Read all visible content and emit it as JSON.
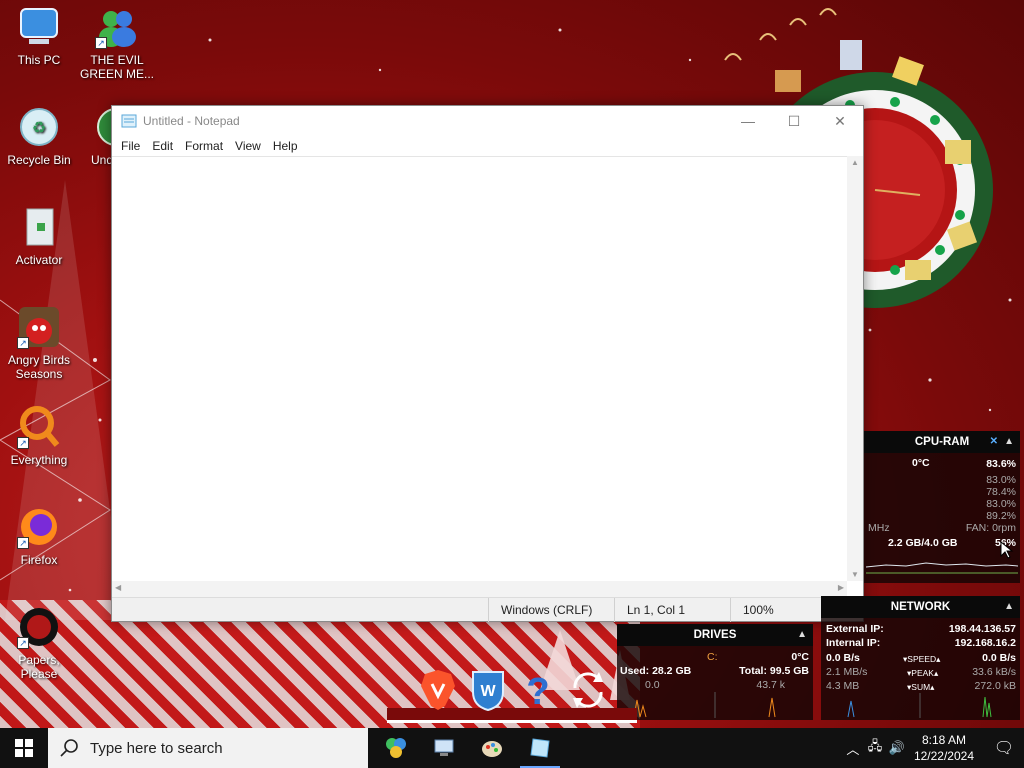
{
  "desktop": {
    "icons": [
      {
        "label": "This PC",
        "icon": "computer-icon"
      },
      {
        "label": "THE EVIL GREEN ME...",
        "icon": "messenger-people-icon"
      },
      {
        "label": "Recycle Bin",
        "icon": "recycle-bin-icon"
      },
      {
        "label": "Und",
        "icon": "green-app-icon"
      },
      {
        "label": "Activator",
        "icon": "activator-icon"
      },
      {
        "label": "Angry Birds Seasons",
        "icon": "angry-birds-icon"
      },
      {
        "label": "Everything",
        "icon": "everything-search-icon"
      },
      {
        "label": "Firefox",
        "icon": "firefox-icon"
      },
      {
        "label": "Papers, Please",
        "icon": "papers-please-icon"
      }
    ]
  },
  "notepad": {
    "title": "Untitled - Notepad",
    "menu": [
      "File",
      "Edit",
      "Format",
      "View",
      "Help"
    ],
    "status": {
      "line_ending": "Windows (CRLF)",
      "position": "Ln 1, Col 1",
      "zoom": "100%"
    },
    "content": ""
  },
  "cpu_ram": {
    "title": "CPU-RAM",
    "temp": "0°C",
    "total_pct": "83.6%",
    "cores": [
      "83.0%",
      "78.4%",
      "83.0%",
      "89.2%"
    ],
    "mhz_label": "MHz",
    "fan": "FAN: 0rpm",
    "ram": "2.2 GB/4.0 GB",
    "ram_pct": "56%"
  },
  "network": {
    "title": "NETWORK",
    "external_label": "External IP:",
    "external_ip": "198.44.136.57",
    "internal_label": "Internal IP:",
    "internal_ip": "192.168.16.2",
    "down_speed": "0.0 B/s",
    "speed_label": "SPEED",
    "up_speed": "0.0 B/s",
    "peak_down": "2.1 MB/s",
    "peak_label": "PEAK",
    "peak_up": "33.6 kB/s",
    "sum_down": "4.3 MB",
    "sum_label": "SUM",
    "sum_up": "272.0 kB"
  },
  "drives": {
    "title": "DRIVES",
    "drive_letter": "C:",
    "temp": "0°C",
    "used": "Used: 28.2 GB",
    "total": "Total: 99.5 GB",
    "read": "0.0",
    "write": "43.7 k"
  },
  "taskbar": {
    "search_placeholder": "Type here to search",
    "time": "8:18 AM",
    "date": "12/22/2024"
  },
  "colors": {
    "wallpaper_red": "#a01010",
    "taskbar": "#111111",
    "accent": "#6aa6ff"
  }
}
